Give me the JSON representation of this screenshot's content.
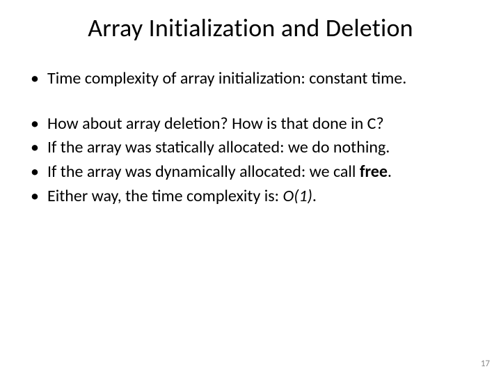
{
  "title": "Array Initialization and Deletion",
  "bullets": {
    "b1": "Time complexity of array initialization: constant time.",
    "b2": "How about array deletion? How is that done in C?",
    "b3": "If the array was statically allocated: we do nothing.",
    "b4_pre": "If the array was dynamically allocated: we call ",
    "b4_bold": "free",
    "b4_post": ".",
    "b5_pre": "Either way, the time complexity is: ",
    "b5_italic": "O(1)",
    "b5_post": "."
  },
  "page_number": "17"
}
